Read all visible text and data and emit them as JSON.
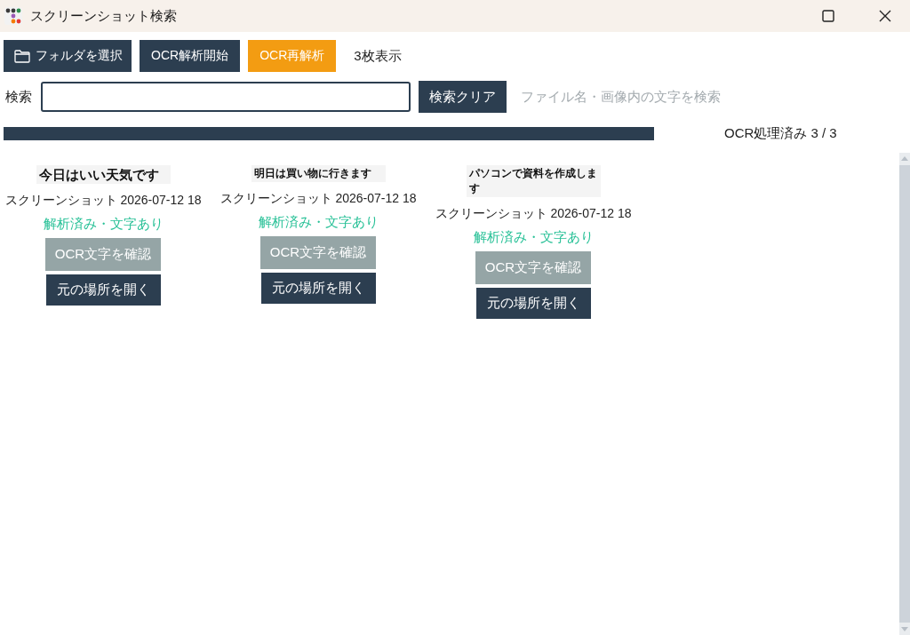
{
  "window": {
    "title": "スクリーンショット検索"
  },
  "toolbar": {
    "buttons": [
      {
        "label": "フォルダを選択",
        "kind": "browse"
      },
      {
        "label": "OCR解析開始",
        "kind": "plain"
      },
      {
        "label": "OCR再解析",
        "kind": "accent"
      }
    ],
    "count": "3枚表示"
  },
  "search": {
    "label": "検索",
    "clear_button": "検索クリア",
    "hint": "ファイル名・画像内の文字を検索"
  },
  "progress": {
    "level": 1,
    "label": "OCR処理済み 3 / 3"
  },
  "cards": [
    {
      "snippet": "今日はいい天気です",
      "filename": "スクリーンショット 2026-07-12 18",
      "status": "解析済み・文字あり",
      "buttons": [
        {
          "label": "OCR文字を確認",
          "kind": "secondary"
        },
        {
          "label": "元の場所を開く",
          "kind": "primary"
        }
      ]
    },
    {
      "snippet": "明日は買い物に行きます",
      "filename": "スクリーンショット 2026-07-12 18",
      "status": "解析済み・文字あり",
      "buttons": [
        {
          "label": "OCR文字を確認",
          "kind": "secondary"
        },
        {
          "label": "元の場所を開く",
          "kind": "primary"
        }
      ]
    },
    {
      "snippet": "パソコンで資料を作成します",
      "filename": "スクリーンショット 2026-07-12 18",
      "status": "解析済み・文字あり",
      "buttons": [
        {
          "label": "OCR文字を確認",
          "kind": "secondary"
        },
        {
          "label": "元の場所を開く",
          "kind": "primary"
        }
      ]
    }
  ]
}
